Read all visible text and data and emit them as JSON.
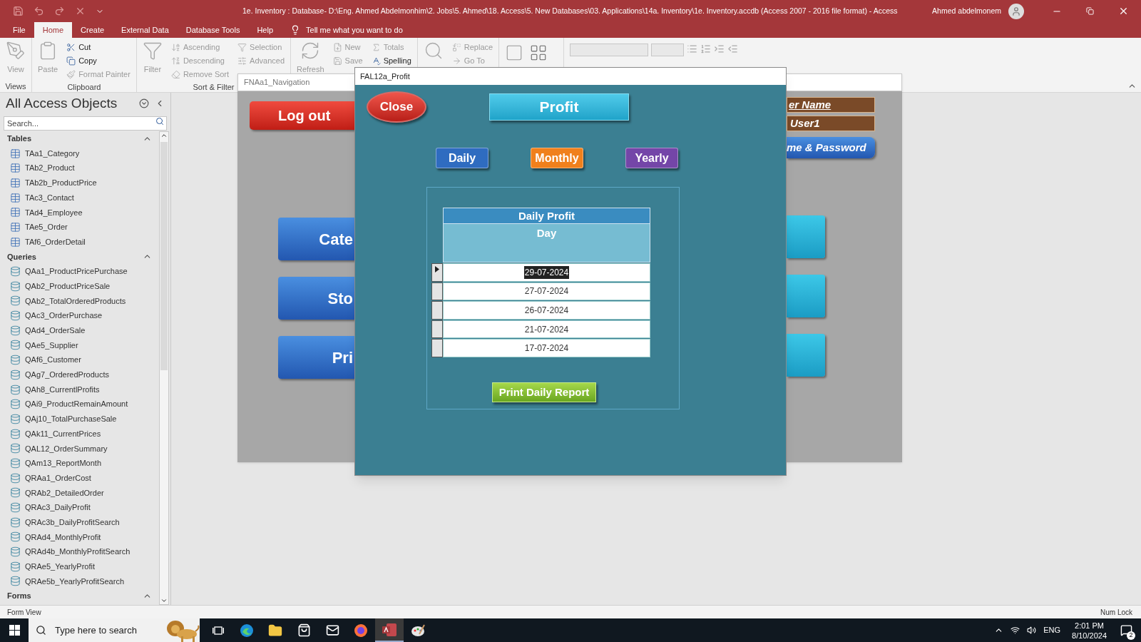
{
  "title_bar": {
    "title": "1e. Inventory : Database- D:\\Eng. Ahmed Abdelmonhim\\2. Jobs\\5. Ahmed\\18. Access\\5. New Databases\\03. Applications\\14a. Inventory\\1e. Inventory.accdb (Access 2007 - 2016 file format)  -  Access",
    "user": "Ahmed abdelmonem"
  },
  "ribbon_tabs": [
    {
      "label": "File",
      "selected": false
    },
    {
      "label": "Home",
      "selected": true
    },
    {
      "label": "Create",
      "selected": false
    },
    {
      "label": "External Data",
      "selected": false
    },
    {
      "label": "Database Tools",
      "selected": false
    },
    {
      "label": "Help",
      "selected": false
    }
  ],
  "tell_me": "Tell me what you want to do",
  "ribbon_groups": [
    {
      "label": "Views",
      "items": [
        {
          "kind": "large",
          "label": "View",
          "disabled": true
        }
      ]
    },
    {
      "label": "Clipboard",
      "items": [
        {
          "kind": "large",
          "label": "Paste",
          "disabled": true
        },
        {
          "kind": "small",
          "label": "Cut",
          "disabled": false
        },
        {
          "kind": "small",
          "label": "Copy",
          "disabled": false
        },
        {
          "kind": "small",
          "label": "Format Painter",
          "disabled": true
        }
      ]
    },
    {
      "label": "Sort & Filter",
      "items": [
        {
          "kind": "large",
          "label": "Filter",
          "disabled": true
        },
        {
          "kind": "small",
          "label": "Ascending",
          "disabled": true
        },
        {
          "kind": "small",
          "label": "Descending",
          "disabled": true
        },
        {
          "kind": "small",
          "label": "Remove Sort",
          "disabled": true
        },
        {
          "kind": "small",
          "label": "Selection",
          "disabled": true
        },
        {
          "kind": "small",
          "label": "Advanced",
          "disabled": true
        }
      ]
    },
    {
      "items": [
        {
          "kind": "large",
          "label": "Refresh",
          "disabled": true
        },
        {
          "kind": "small",
          "label": "New",
          "disabled": true
        },
        {
          "kind": "small",
          "label": "Save",
          "disabled": true
        },
        {
          "kind": "small",
          "label": "Totals",
          "disabled": true
        },
        {
          "kind": "small",
          "label": "Spelling",
          "disabled": false
        }
      ]
    },
    {
      "items": [
        {
          "kind": "large",
          "disabled": true
        },
        {
          "kind": "small",
          "label": "Replace",
          "disabled": true
        },
        {
          "kind": "small",
          "label": "Go To",
          "disabled": true
        }
      ]
    }
  ],
  "nav_pane": {
    "title": "All Access Objects",
    "search_placeholder": "Search...",
    "groups": [
      {
        "label": "Tables",
        "kind": "table",
        "expanded": true,
        "items": [
          "TAa1_Category",
          "TAb2_Product",
          "TAb2b_ProductPrice",
          "TAc3_Contact",
          "TAd4_Employee",
          "TAe5_Order",
          "TAf6_OrderDetail"
        ]
      },
      {
        "label": "Queries",
        "kind": "query",
        "expanded": true,
        "items": [
          "QAa1_ProductPricePurchase",
          "QAb2_ProductPriceSale",
          "QAb2_TotalOrderedProducts",
          "QAc3_OrderPurchase",
          "QAd4_OrderSale",
          "QAe5_Supplier",
          "QAf6_Customer",
          "QAg7_OrderedProducts",
          "QAh8_CurrentlProfits",
          "QAi9_ProductRemainAmount",
          "QAj10_TotalPurchaseSale",
          "QAk11_CurrentPrices",
          "QAL12_OrderSummary",
          "QAm13_ReportMonth",
          "QRAa1_OrderCost",
          "QRAb2_DetailedOrder",
          "QRAc3_DailyProfit",
          "QRAc3b_DailyProfitSearch",
          "QRAd4_MonthlyProfit",
          "QRAd4b_MonthlyProfitSearch",
          "QRAe5_YearlyProfit",
          "QRAe5b_YearlyProfitSearch"
        ]
      },
      {
        "label": "Forms",
        "expanded": true
      }
    ]
  },
  "navigation_form": {
    "tab": "FNAa1_Navigation",
    "logout": "Log out",
    "left_buttons": [
      "Cate",
      "Sto",
      "Pri"
    ],
    "user_label": "er Name",
    "user_value": "User1",
    "password_button": "me & Password"
  },
  "dialog": {
    "title": "FAL12a_Profit",
    "close": "Close",
    "heading": "Profit",
    "period_buttons": [
      {
        "label": "Daily",
        "color": "#2f6cc0"
      },
      {
        "label": "Monthly",
        "color": "#f0801c"
      },
      {
        "label": "Yearly",
        "color": "#7446a8"
      }
    ],
    "datasheet": {
      "title": "Daily Profit",
      "column": "Day",
      "rows": [
        {
          "value": "29-07-2024",
          "selected": true
        },
        {
          "value": "27-07-2024",
          "selected": false
        },
        {
          "value": "26-07-2024",
          "selected": false
        },
        {
          "value": "21-07-2024",
          "selected": false
        },
        {
          "value": "17-07-2024",
          "selected": false
        }
      ]
    },
    "print_button": "Print Daily Report"
  },
  "status_bar": {
    "left": "Form View",
    "right": "Num Lock"
  },
  "taskbar": {
    "search_placeholder": "Type here to search",
    "language": "ENG",
    "time": "2:01 PM",
    "date": "8/10/2024",
    "notifications": "2"
  }
}
